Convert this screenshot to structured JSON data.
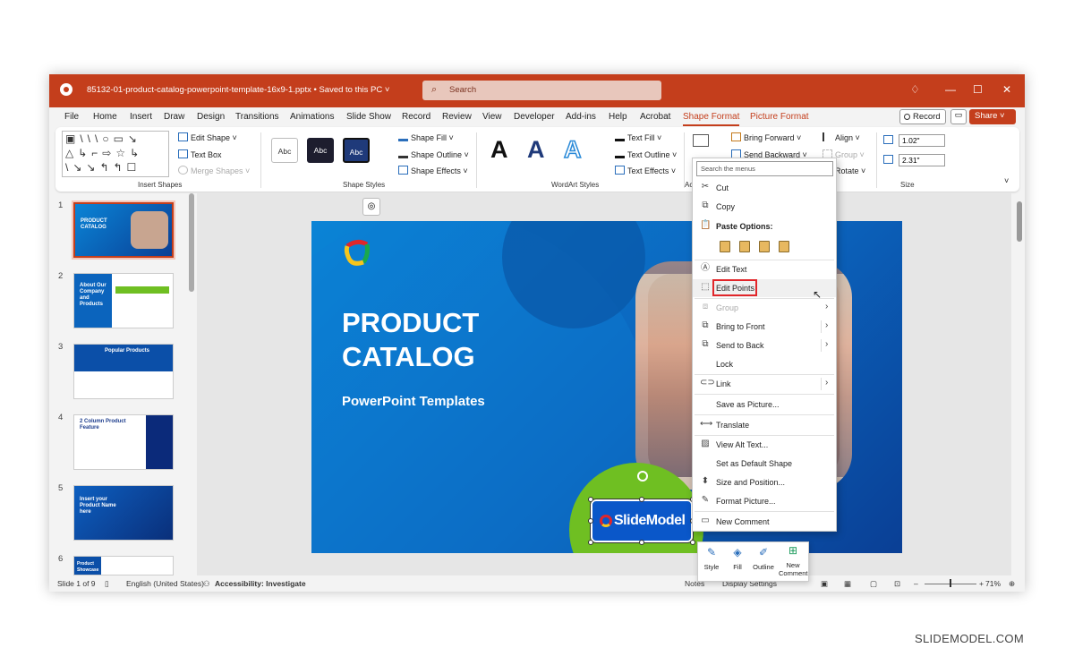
{
  "window": {
    "doc_title": "85132-01-product-catalog-powerpoint-template-16x9-1.pptx • Saved to this PC ˅",
    "search_placeholder": "Search"
  },
  "tabs": [
    "File",
    "Home",
    "Insert",
    "Draw",
    "Design",
    "Transitions",
    "Animations",
    "Slide Show",
    "Record",
    "Review",
    "View",
    "Developer",
    "Add-ins",
    "Help",
    "Acrobat",
    "Shape Format",
    "Picture Format"
  ],
  "active_tab": "Shape Format",
  "header_buttons": {
    "record": "Record",
    "share": "Share ˅"
  },
  "ribbon": {
    "insert_shapes": {
      "edit_shape": "Edit Shape ˅",
      "text_box": "Text Box",
      "merge_shapes": "Merge Shapes ˅",
      "label": "Insert Shapes"
    },
    "shape_styles": {
      "swatch": "Abc",
      "shape_fill": "Shape Fill ˅",
      "shape_outline": "Shape Outline ˅",
      "shape_effects": "Shape Effects ˅",
      "label": "Shape Styles"
    },
    "wordart": {
      "sample": "A",
      "text_fill": "Text Fill ˅",
      "text_outline": "Text Outline ˅",
      "text_effects": "Text Effects ˅",
      "label": "WordArt Styles"
    },
    "accessibility_label": "Ac",
    "arrange": {
      "bring_forward": "Bring Forward ˅",
      "send_backward": "Send Backward ˅",
      "align": "Align ˅",
      "group": "Group ˅",
      "rotate": "Rotate ˅"
    },
    "size": {
      "height": "1.02\"",
      "width": "2.31\"",
      "label": "Size"
    }
  },
  "thumbnails": [
    {
      "num": "1",
      "title": "PRODUCT CATALOG",
      "selected": true
    },
    {
      "num": "2",
      "title": "About Our Company and Products",
      "selected": false
    },
    {
      "num": "3",
      "title": "Popular Products",
      "selected": false
    },
    {
      "num": "4",
      "title": "2 Column Product Feature",
      "selected": false
    },
    {
      "num": "5",
      "title": "Insert your Product Name here",
      "selected": false
    },
    {
      "num": "6",
      "title": "Product Showcase",
      "selected": false
    }
  ],
  "slide": {
    "title": "PRODUCT CATALOG",
    "subtitle": "PowerPoint Templates",
    "logo_text": "SlideModel"
  },
  "context_menu": {
    "search_placeholder": "Search the menus",
    "items": [
      {
        "label": "Cut",
        "icon": "scissors-icon"
      },
      {
        "label": "Copy",
        "icon": "copy-icon"
      },
      {
        "label": "Paste Options:",
        "icon": "paste-icon"
      },
      {
        "label": "Edit Text",
        "icon": "edit-text-icon"
      },
      {
        "label": "Edit Points",
        "icon": "edit-points-icon"
      },
      {
        "label": "Group",
        "icon": "group-icon",
        "disabled": true
      },
      {
        "label": "Bring to Front",
        "icon": "bring-front-icon"
      },
      {
        "label": "Send to Back",
        "icon": "send-back-icon"
      },
      {
        "label": "Lock",
        "icon": "lock-icon"
      },
      {
        "label": "Link",
        "icon": "link-icon"
      },
      {
        "label": "Save as Picture...",
        "icon": ""
      },
      {
        "label": "Translate",
        "icon": "translate-icon"
      },
      {
        "label": "View Alt Text...",
        "icon": "alt-text-icon"
      },
      {
        "label": "Set as Default Shape",
        "icon": ""
      },
      {
        "label": "Size and Position...",
        "icon": "size-position-icon"
      },
      {
        "label": "Format Picture...",
        "icon": "format-picture-icon"
      },
      {
        "label": "New Comment",
        "icon": "comment-icon"
      }
    ]
  },
  "mini_toolbar": {
    "style": "Style",
    "fill": "Fill",
    "outline": "Outline",
    "new_comment": "New Comment"
  },
  "status": {
    "slide_count": "Slide 1 of 9",
    "language": "English (United States)",
    "accessibility": "Accessibility: Investigate",
    "notes": "Notes",
    "display_settings": "Display Settings",
    "zoom": "71%"
  },
  "watermark": "SLIDEMODEL.COM",
  "colors": {
    "accent": "#c43e1c",
    "highlight": "#e1262a",
    "slide_blue": "#0b64bd",
    "green": "#6fbf22"
  }
}
